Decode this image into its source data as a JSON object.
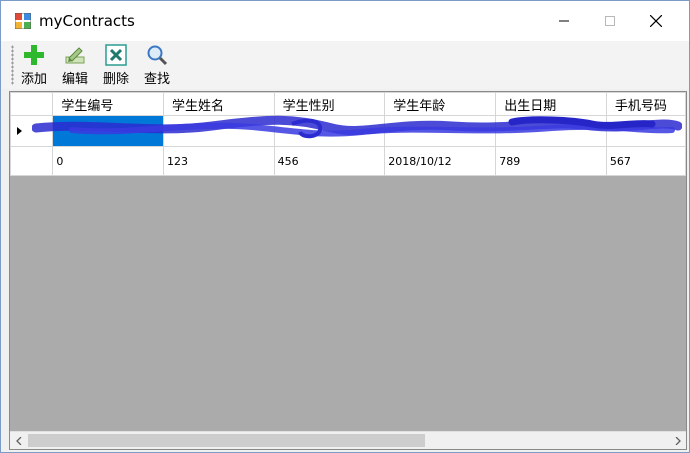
{
  "window": {
    "title": "myContracts",
    "app_icon": "app-window-icon",
    "controls": [
      "minimize-icon",
      "maximize-icon",
      "close-icon"
    ]
  },
  "toolbar": {
    "items": [
      {
        "label": "添加",
        "icon": "add-plus-icon",
        "color": "#2eb82e"
      },
      {
        "label": "编辑",
        "icon": "edit-pencil-icon",
        "color": "#6aa84f"
      },
      {
        "label": "删除",
        "icon": "delete-x-icon",
        "color": "#2a9d8f"
      },
      {
        "label": "查找",
        "icon": "search-magnifier-icon",
        "color": "#3b78c4"
      }
    ]
  },
  "grid": {
    "columns": [
      "学生编号",
      "学生姓名",
      "学生性别",
      "学生年龄",
      "出生日期",
      "手机号码"
    ],
    "rows": [
      {
        "cells": [
          "",
          "",
          "",
          "",
          "",
          ""
        ],
        "redacted": true,
        "current": true
      },
      {
        "cells": [
          "0",
          "123",
          "456",
          "2018/10/12",
          "789",
          "567"
        ],
        "redacted": false,
        "current": false
      }
    ],
    "selection_color": "#0078d7",
    "redaction_color": "#2b2bd0",
    "background_color": "#ababab"
  },
  "scrollbar": {
    "left_arrow": "scroll-left-icon",
    "right_arrow": "scroll-right-icon"
  }
}
